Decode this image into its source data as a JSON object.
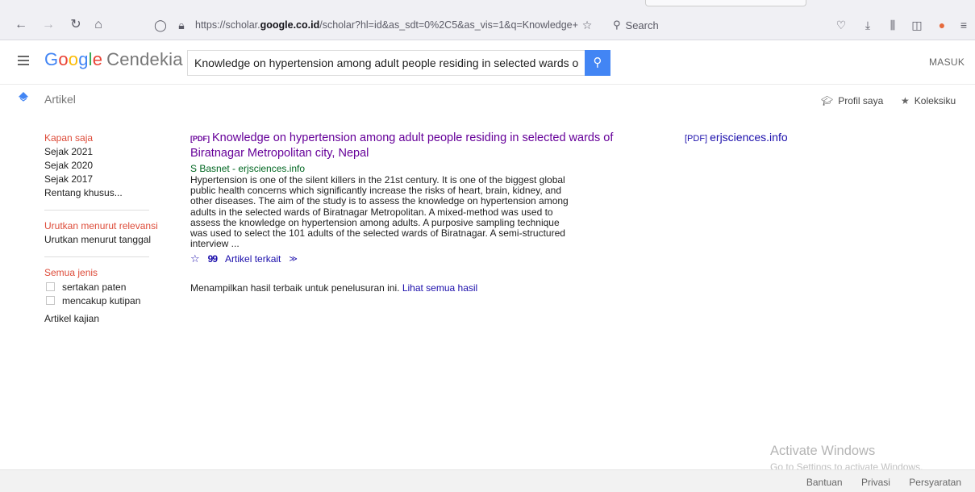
{
  "browser": {
    "url_prefix": "https://scholar.",
    "url_domain": "google.co.id",
    "url_rest": "/scholar?hl=id&as_sdt=0%2C5&as_vis=1&q=Knowledge+",
    "search_placeholder": "Search"
  },
  "header": {
    "logo_letters": [
      "G",
      "o",
      "o",
      "g",
      "l",
      "e"
    ],
    "logo_suffix": "Cendekia",
    "query": "Knowledge on hypertension among adult people residing in selected wards o",
    "signin": "MASUK"
  },
  "subheader": {
    "section": "Artikel",
    "profile": "Profil saya",
    "library": "Koleksiku"
  },
  "sidebar": {
    "time": [
      "Kapan saja",
      "Sejak 2021",
      "Sejak 2020",
      "Sejak 2017",
      "Rentang khusus..."
    ],
    "sort": [
      "Urutkan menurut relevansi",
      "Urutkan menurut tanggal"
    ],
    "type": "Semua jenis",
    "checks": [
      "sertakan paten",
      "mencakup kutipan"
    ],
    "review": "Artikel kajian"
  },
  "result": {
    "pdf_tag": "[PDF]",
    "title": "Knowledge on hypertension among adult people residing in selected wards of Biratnagar Metropolitan city, Nepal",
    "author_source": "S Basnet - erjsciences.info",
    "snippet": "Hypertension is one of the silent killers in the 21st century. It is one of the biggest global public health concerns which significantly increase the risks of heart, brain, kidney, and other diseases. The aim of the study is to assess the knowledge on hypertension among adults in the selected wards of Biratnagar Metropolitan. A mixed-method was used to assess the knowledge on hypertension among adults. A purposive sampling technique was used to select the 101 adults of the selected wards of Biratnagar. A semi-structured interview ...",
    "related": "Artikel terkait",
    "note": "Menampilkan hasil terbaik untuk penelusuran ini.",
    "note_link": "Lihat semua hasil",
    "side_pdf_tag": "[PDF]",
    "side_pdf_source": "erjsciences.info"
  },
  "watermark": {
    "line1": "Activate Windows",
    "line2": "Go to Settings to activate Windows."
  },
  "footer": {
    "links": [
      "Bantuan",
      "Privasi",
      "Persyaratan"
    ]
  }
}
